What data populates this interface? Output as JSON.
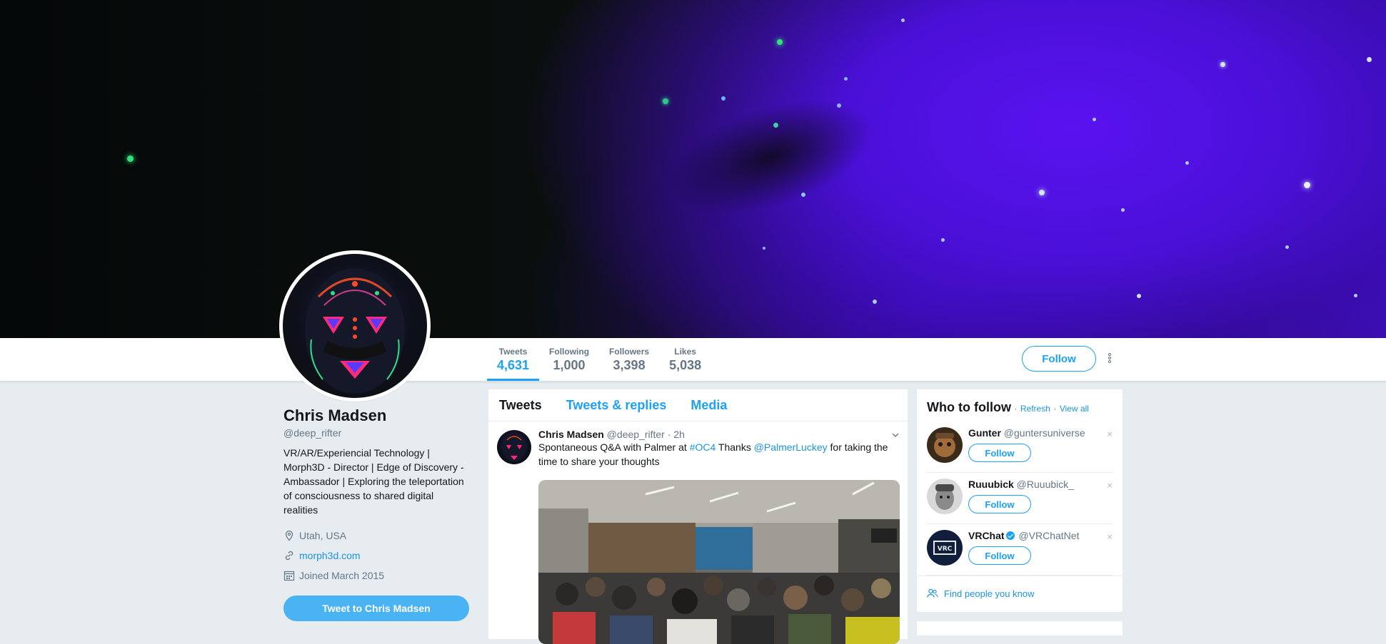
{
  "profile": {
    "name": "Chris Madsen",
    "handle": "@deep_rifter",
    "bio": "VR/AR/Experiencial Technology | Morph3D - Director | Edge of Discovery - Ambassador | Exploring the teleportation of consciousness to shared digital realities",
    "location": "Utah, USA",
    "website": "morph3d.com",
    "joined": "Joined March 2015",
    "tweet_to_label": "Tweet to Chris Madsen"
  },
  "stats": [
    {
      "label": "Tweets",
      "value": "4,631"
    },
    {
      "label": "Following",
      "value": "1,000"
    },
    {
      "label": "Followers",
      "value": "3,398"
    },
    {
      "label": "Likes",
      "value": "5,038"
    }
  ],
  "navbar": {
    "follow_label": "Follow"
  },
  "timeline": {
    "tabs": [
      "Tweets",
      "Tweets & replies",
      "Media"
    ],
    "tweet": {
      "name": "Chris Madsen",
      "handle": "@deep_rifter",
      "time": "· 2h",
      "text_1": "Spontaneous Q&A with Palmer at ",
      "hashtag": "#OC4",
      "text_2": " Thanks ",
      "mention": "@PalmerLuckey",
      "text_3": " for taking the time to share your thoughts"
    }
  },
  "who_to_follow": {
    "title": "Who to follow",
    "refresh": "Refresh",
    "separator": "·",
    "view_all": "View all",
    "follow_label": "Follow",
    "close_glyph": "×",
    "users": [
      {
        "name": "Gunter",
        "handle": "@guntersuniverse",
        "verified": false
      },
      {
        "name": "Ruuubick",
        "handle": "@Ruuubick_",
        "verified": false
      },
      {
        "name": "VRChat",
        "handle": "@VRChatNet",
        "verified": true
      }
    ],
    "find_people": "Find people you know"
  },
  "colors": {
    "accent": "#1da1f2",
    "link": "#1b95e0",
    "background": "#e6ecf0"
  }
}
